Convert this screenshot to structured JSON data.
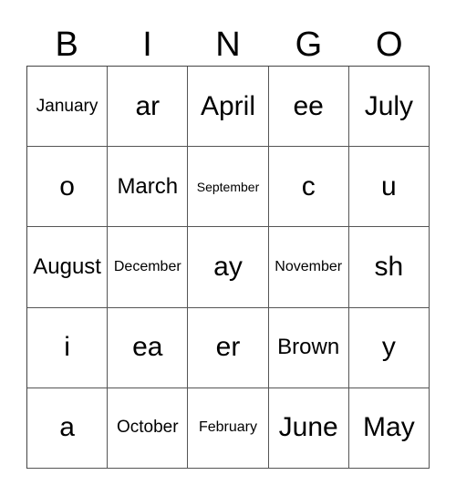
{
  "header": {
    "letters": [
      "B",
      "I",
      "N",
      "G",
      "O"
    ]
  },
  "board": {
    "rows": [
      [
        "January",
        "ar",
        "April",
        "ee",
        "July"
      ],
      [
        "o",
        "March",
        "September",
        "c",
        "u"
      ],
      [
        "August",
        "December",
        "ay",
        "November",
        "sh"
      ],
      [
        "i",
        "ea",
        "er",
        "Brown",
        "y"
      ],
      [
        "a",
        "October",
        "February",
        "June",
        "May"
      ]
    ]
  }
}
